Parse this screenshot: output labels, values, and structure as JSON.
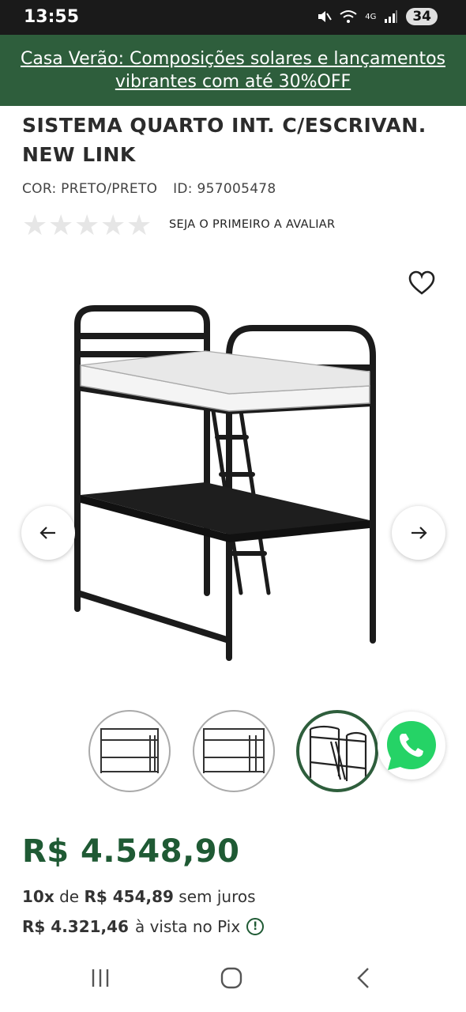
{
  "status_bar": {
    "time": "13:55",
    "network": "4G",
    "battery": "34"
  },
  "promo": {
    "text": "Casa Verão: Composições solares e lançamentos vibrantes com até 30%OFF"
  },
  "product": {
    "title": "SISTEMA QUARTO INT. C/ESCRIVAN. NEW LINK",
    "color": "COR: PRETO/PRETO",
    "id": "ID: 957005478",
    "rating_stars": 5,
    "rating_value": 0,
    "review_cta": "SEJA O PRIMEIRO A AVALIAR"
  },
  "gallery": {
    "prev_icon": "arrow-left-icon",
    "next_icon": "arrow-right-icon",
    "favorite_icon": "heart-icon",
    "thumbnails": [
      {
        "active": false
      },
      {
        "active": false
      },
      {
        "active": true
      }
    ]
  },
  "pricing": {
    "price": "R$ 4.548,90",
    "installments_count": "10x",
    "installments_de": "de",
    "installments_value": "R$ 454,89",
    "installments_suffix": "sem juros",
    "pix_value": "R$ 4.321,46",
    "pix_suffix": "à vista no Pix",
    "info_icon": "!"
  },
  "colors": {
    "brand_green": "#2e5e3c",
    "price_green": "#1f5a34",
    "whatsapp": "#25d366"
  }
}
